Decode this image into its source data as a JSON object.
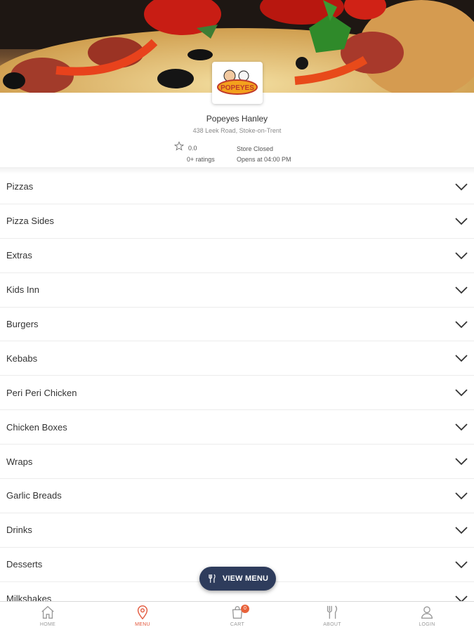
{
  "store": {
    "name": "Popeyes Hanley",
    "address": "438 Leek Road, Stoke-on-Trent",
    "rating_value": "0.0",
    "rating_count": "0+ ratings",
    "status": "Store Closed",
    "opens": "Opens at 04:00 PM",
    "logo_text": "POPEYES"
  },
  "categories": [
    {
      "label": "Pizzas"
    },
    {
      "label": "Pizza Sides"
    },
    {
      "label": "Extras"
    },
    {
      "label": "Kids Inn"
    },
    {
      "label": "Burgers"
    },
    {
      "label": "Kebabs"
    },
    {
      "label": "Peri Peri Chicken"
    },
    {
      "label": "Chicken Boxes"
    },
    {
      "label": "Wraps"
    },
    {
      "label": "Garlic Breads"
    },
    {
      "label": "Drinks"
    },
    {
      "label": "Desserts"
    },
    {
      "label": "Milkshakes"
    }
  ],
  "view_menu_button": {
    "label": "VIEW MENU"
  },
  "bottom_nav": {
    "home": "HOME",
    "menu": "MENU",
    "cart": "CART",
    "cart_count": "0",
    "about": "ABOUT",
    "login": "LOGIN"
  },
  "colors": {
    "accent": "#e2573b",
    "button_bg": "#2e3c5c",
    "badge": "#e8623b"
  }
}
